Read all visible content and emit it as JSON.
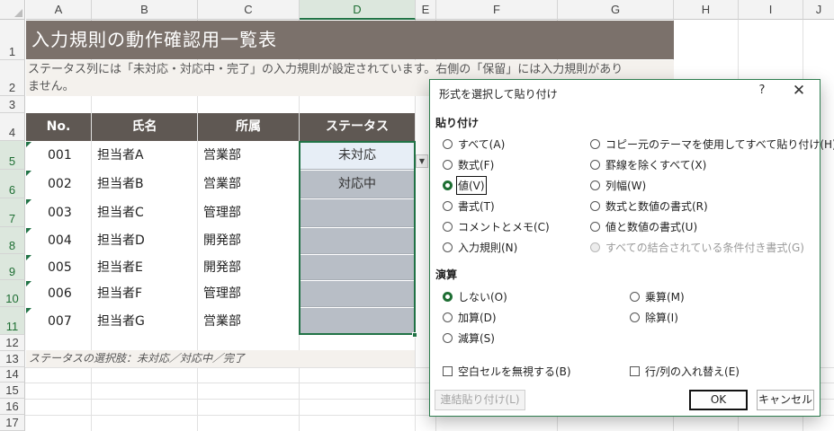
{
  "columns": [
    "A",
    "B",
    "C",
    "D",
    "E",
    "F",
    "G",
    "H",
    "I",
    "J"
  ],
  "rows": [
    "1",
    "2",
    "3",
    "4",
    "5",
    "6",
    "7",
    "8",
    "9",
    "10",
    "11",
    "12",
    "13",
    "14",
    "15",
    "16",
    "17"
  ],
  "sheet": {
    "title": "入力規則の動作確認用一覧表",
    "desc_line1": "ステータス列には「未対応・対応中・完了」の入力規則が設定されています。右側の「保留」には入力規則があり",
    "desc_line2": "ません。",
    "headers": [
      "No.",
      "氏名",
      "所属",
      "ステータス"
    ],
    "data": [
      {
        "no": "001",
        "name": "担当者A",
        "dept": "営業部",
        "status": "未対応"
      },
      {
        "no": "002",
        "name": "担当者B",
        "dept": "営業部",
        "status": "対応中"
      },
      {
        "no": "003",
        "name": "担当者C",
        "dept": "管理部",
        "status": ""
      },
      {
        "no": "004",
        "name": "担当者D",
        "dept": "開発部",
        "status": ""
      },
      {
        "no": "005",
        "name": "担当者E",
        "dept": "開発部",
        "status": ""
      },
      {
        "no": "006",
        "name": "担当者F",
        "dept": "管理部",
        "status": ""
      },
      {
        "no": "007",
        "name": "担当者G",
        "dept": "営業部",
        "status": ""
      }
    ],
    "note": "ステータスの選択肢：未対応／対応中／完了"
  },
  "dialog": {
    "title": "形式を選択して貼り付け",
    "help": "?",
    "close": "✕",
    "paste_group": "貼り付け",
    "paste_left": [
      "すべて(A)",
      "数式(F)",
      "値(V)",
      "書式(T)",
      "コメントとメモ(C)",
      "入力規則(N)"
    ],
    "paste_right": [
      "コピー元のテーマを使用してすべて貼り付け(H)",
      "罫線を除くすべて(X)",
      "列幅(W)",
      "数式と数値の書式(R)",
      "値と数値の書式(U)",
      "すべての結合されている条件付き書式(G)"
    ],
    "op_group": "演算",
    "op_left": [
      "しない(O)",
      "加算(D)",
      "減算(S)"
    ],
    "op_right": [
      "乗算(M)",
      "除算(I)"
    ],
    "skip_blanks": "空白セルを無視する(B)",
    "transpose": "行/列の入れ替え(E)",
    "paste_link": "連結貼り付け(L)",
    "ok": "OK",
    "cancel": "キャンセル"
  }
}
